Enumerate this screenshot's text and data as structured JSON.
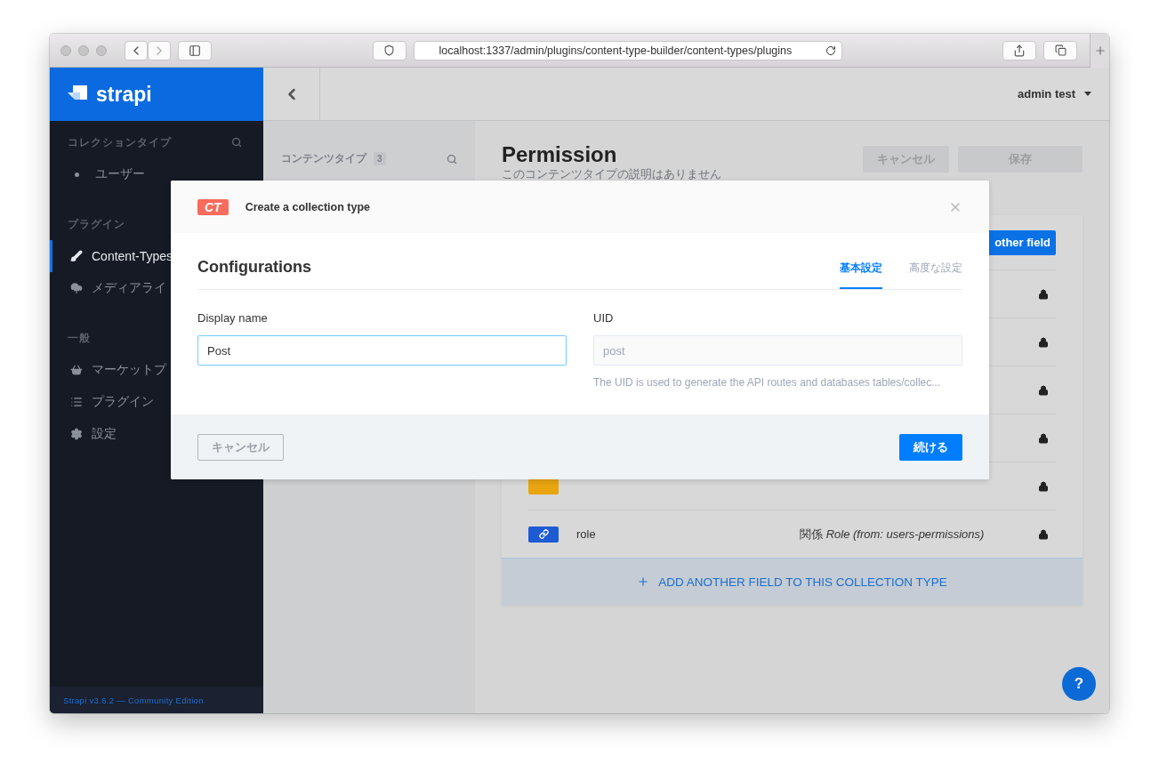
{
  "browser": {
    "url": "localhost:1337/admin/plugins/content-type-builder/content-types/plugins"
  },
  "sidebar": {
    "logo": "strapi",
    "sections": [
      {
        "title": "コレクションタイプ",
        "search": true,
        "items": [
          {
            "label": "ユーザー",
            "kind": "bullet",
            "selected": false
          }
        ]
      },
      {
        "title": "プラグイン",
        "search": false,
        "items": [
          {
            "label": "Content-Types",
            "kind": "icon",
            "selected": true
          },
          {
            "label": "メディアライ",
            "kind": "icon",
            "selected": false
          }
        ]
      },
      {
        "title": "一般",
        "search": false,
        "items": [
          {
            "label": "マーケットプ",
            "kind": "icon",
            "selected": false
          },
          {
            "label": "プラグイン",
            "kind": "icon",
            "selected": false
          },
          {
            "label": "設定",
            "kind": "icon",
            "selected": false
          }
        ]
      }
    ],
    "footer": "Strapi v3.6.2 — Community Edition"
  },
  "header": {
    "user": "admin test"
  },
  "content_types_panel": {
    "title": "コンテンツタイプ",
    "count": "3"
  },
  "page": {
    "title": "Permission",
    "description": "このコンテンツタイプの説明はありません",
    "buttons": [
      "キャンセル",
      "保存"
    ]
  },
  "fields_table": {
    "add_button": "other field",
    "rows": [
      {
        "kind": "hidden",
        "locked": true
      },
      {
        "kind": "hidden",
        "locked": true
      },
      {
        "kind": "hidden",
        "locked": true
      },
      {
        "kind": "hidden",
        "locked": true
      },
      {
        "kind": "text",
        "locked": true
      },
      {
        "kind": "relation",
        "name": "role",
        "type": "関係 *Role (from: users-permissions)*",
        "locked": true
      }
    ],
    "add_field": "ADD ANOTHER FIELD TO THIS COLLECTION TYPE"
  },
  "help": "?",
  "modal": {
    "badge": "CT",
    "title": "Create a collection type",
    "heading": "Configurations",
    "tabs": [
      {
        "label": "基本設定",
        "selected": true
      },
      {
        "label": "高度な設定",
        "selected": false
      }
    ],
    "fields": [
      {
        "label": "Display name",
        "value": "Post",
        "focused": true,
        "disabled": false
      },
      {
        "label": "UID",
        "value": "post",
        "focused": false,
        "disabled": true,
        "hint": "The UID is used to generate the API routes and databases tables/collec..."
      }
    ],
    "cancel": "キャンセル",
    "continue": "続ける"
  }
}
